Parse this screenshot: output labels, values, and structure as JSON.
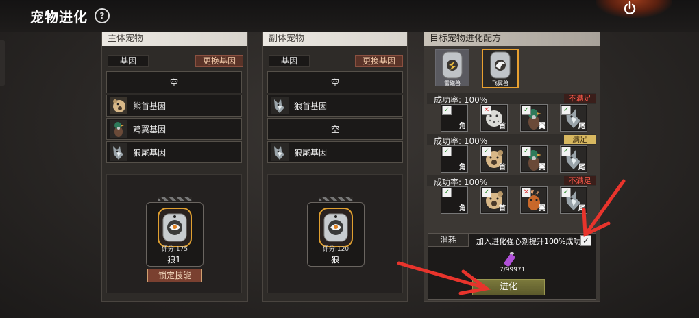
{
  "header": {
    "title": "宠物进化",
    "help_glyph": "?",
    "power_icon": "power-icon"
  },
  "main_pet": {
    "panel_title": "主体宠物",
    "gene_tab": "基因",
    "swap_button": "更换基因",
    "genes": [
      {
        "label": "空",
        "icon": null
      },
      {
        "label": "熊首基因",
        "icon": "bear-head-icon"
      },
      {
        "label": "鸡翼基因",
        "icon": "chicken-wing-icon"
      },
      {
        "label": "狼尾基因",
        "icon": "wolf-tail-icon"
      }
    ],
    "pet": {
      "name": "狼1",
      "score": "评分:175"
    },
    "lock_button": "锁定技能"
  },
  "secondary_pet": {
    "panel_title": "副体宠物",
    "gene_tab": "基因",
    "swap_button": "更换基因",
    "genes": [
      {
        "label": "空",
        "icon": null
      },
      {
        "label": "狼首基因",
        "icon": "wolf-head-icon"
      },
      {
        "label": "空",
        "icon": null
      },
      {
        "label": "狼尾基因",
        "icon": "wolf-tail-icon"
      }
    ],
    "pet": {
      "name": "狼",
      "score": "评分:120"
    }
  },
  "recipe": {
    "panel_title": "目标宠物进化配方",
    "targets": [
      {
        "name": "雷磁兽",
        "selected": false
      },
      {
        "name": "飞翼兽",
        "selected": true
      }
    ],
    "rows": [
      {
        "rate": "成功率: 100%",
        "status": "不满足",
        "status_ok": false,
        "slots": [
          {
            "label": "角",
            "mark": "ok",
            "icon": "empty-slot"
          },
          {
            "label": "首",
            "mark": "no",
            "icon": "leopard-head-icon"
          },
          {
            "label": "翼",
            "mark": "ok",
            "icon": "chicken-wing-icon"
          },
          {
            "label": "尾",
            "mark": "ok",
            "icon": "wolf-tail-icon"
          }
        ]
      },
      {
        "rate": "成功率: 100%",
        "status": "满足",
        "status_ok": true,
        "slots": [
          {
            "label": "角",
            "mark": "ok",
            "icon": "empty-slot"
          },
          {
            "label": "首",
            "mark": "ok",
            "icon": "bear-head-icon"
          },
          {
            "label": "翼",
            "mark": "ok",
            "icon": "chicken-wing-icon"
          },
          {
            "label": "尾",
            "mark": "ok",
            "icon": "wolf-tail-icon"
          }
        ]
      },
      {
        "rate": "成功率: 100%",
        "status": "不满足",
        "status_ok": false,
        "slots": [
          {
            "label": "角",
            "mark": "ok",
            "icon": "empty-slot"
          },
          {
            "label": "首",
            "mark": "ok",
            "icon": "bear-head-icon"
          },
          {
            "label": "翼",
            "mark": "no",
            "icon": "deer-wing-icon"
          },
          {
            "label": "尾",
            "mark": "ok",
            "icon": "wolf-tail-icon"
          }
        ]
      }
    ]
  },
  "cost": {
    "tab": "消耗",
    "description": "加入进化强心剂提升100%成功率",
    "checkbox_checked": true,
    "checkbox_glyph": "✓",
    "item_icon": "potion-icon",
    "item_count": "7/99971",
    "evolve_button": "进化"
  },
  "annotations": {
    "arrow_color": "#e8342c"
  }
}
